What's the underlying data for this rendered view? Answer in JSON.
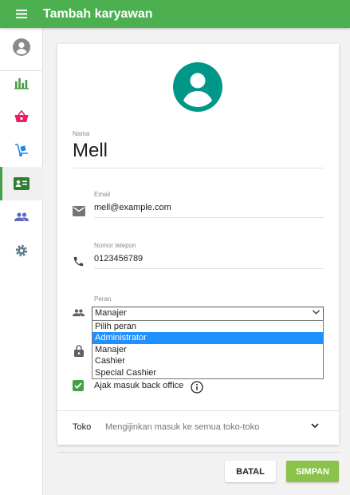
{
  "header": {
    "title": "Tambah karyawan",
    "bar_color": "#4caf50"
  },
  "sidebar": {
    "items": [
      {
        "icon": "account-circle-icon",
        "active": false
      },
      {
        "icon": "bar-chart-icon",
        "active": false
      },
      {
        "icon": "basket-icon",
        "active": false
      },
      {
        "icon": "hand-truck-icon",
        "active": false
      },
      {
        "icon": "employee-card-icon",
        "active": true
      },
      {
        "icon": "people-icon",
        "active": false
      },
      {
        "icon": "gear-icon",
        "active": false
      }
    ]
  },
  "form": {
    "name_label": "Nama",
    "name_value": "Mell",
    "email_label": "Email",
    "email_value": "mell@example.com",
    "phone_label": "Nomor telepon",
    "phone_value": "0123456789",
    "role_label": "Peran",
    "role_value": "Manajer",
    "role_options": [
      "Pilih peran",
      "Administrator",
      "Manajer",
      "Cashier",
      "Special Cashier"
    ],
    "highlighted_option": "Administrator",
    "backoffice_label": "Ajak masuk back office",
    "backoffice_checked": true,
    "toko_label": "Toko",
    "toko_desc": "Mengijinkan masuk ke semua toko-toko"
  },
  "actions": {
    "cancel_label": "BATAL",
    "save_label": "SIMPAN"
  },
  "colors": {
    "accent": "#43a047",
    "avatar": "#009688",
    "save": "#8bc34a",
    "highlight": "#1e90ff"
  }
}
